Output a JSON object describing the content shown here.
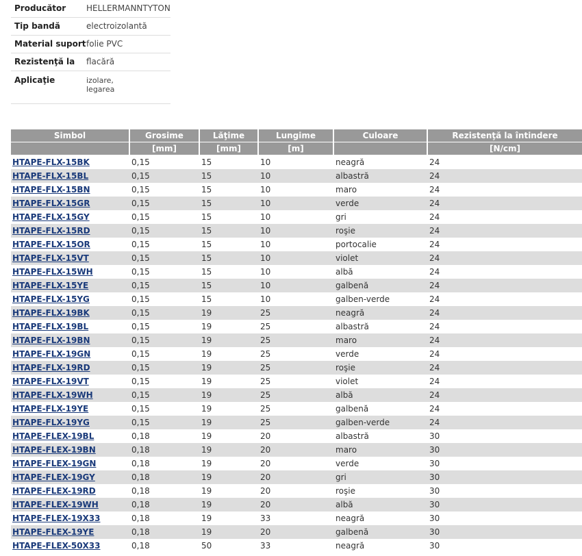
{
  "properties": [
    {
      "key": "Producător",
      "value": "HELLERMANNTYTON"
    },
    {
      "key": "Tip bandă",
      "value": "electroizolantă"
    },
    {
      "key": "Material suport",
      "value": "folie PVC"
    },
    {
      "key": "Rezistenţă la",
      "value": "flacără"
    },
    {
      "key": "Aplicaţie",
      "value": "izolare,\nlegarea"
    }
  ],
  "table": {
    "headers": [
      "Simbol",
      "Grosime",
      "Lăţime",
      "Lungime",
      "Culoare",
      "Rezistenţă la întindere"
    ],
    "units": [
      "",
      "[mm]",
      "[mm]",
      "[m]",
      "",
      "[N/cm]"
    ],
    "rows": [
      [
        "HTAPE-FLX-15BK",
        "0,15",
        "15",
        "10",
        "neagră",
        "24"
      ],
      [
        "HTAPE-FLX-15BL",
        "0,15",
        "15",
        "10",
        "albastră",
        "24"
      ],
      [
        "HTAPE-FLX-15BN",
        "0,15",
        "15",
        "10",
        "maro",
        "24"
      ],
      [
        "HTAPE-FLX-15GR",
        "0,15",
        "15",
        "10",
        "verde",
        "24"
      ],
      [
        "HTAPE-FLX-15GY",
        "0,15",
        "15",
        "10",
        "gri",
        "24"
      ],
      [
        "HTAPE-FLX-15RD",
        "0,15",
        "15",
        "10",
        "roşie",
        "24"
      ],
      [
        "HTAPE-FLX-15OR",
        "0,15",
        "15",
        "10",
        "portocalie",
        "24"
      ],
      [
        "HTAPE-FLX-15VT",
        "0,15",
        "15",
        "10",
        "violet",
        "24"
      ],
      [
        "HTAPE-FLX-15WH",
        "0,15",
        "15",
        "10",
        "albă",
        "24"
      ],
      [
        "HTAPE-FLX-15YE",
        "0,15",
        "15",
        "10",
        "galbenă",
        "24"
      ],
      [
        "HTAPE-FLX-15YG",
        "0,15",
        "15",
        "10",
        "galben-verde",
        "24"
      ],
      [
        "HTAPE-FLX-19BK",
        "0,15",
        "19",
        "25",
        "neagră",
        "24"
      ],
      [
        "HTAPE-FLX-19BL",
        "0,15",
        "19",
        "25",
        "albastră",
        "24"
      ],
      [
        "HTAPE-FLX-19BN",
        "0,15",
        "19",
        "25",
        "maro",
        "24"
      ],
      [
        "HTAPE-FLX-19GN",
        "0,15",
        "19",
        "25",
        "verde",
        "24"
      ],
      [
        "HTAPE-FLX-19RD",
        "0,15",
        "19",
        "25",
        "roşie",
        "24"
      ],
      [
        "HTAPE-FLX-19VT",
        "0,15",
        "19",
        "25",
        "violet",
        "24"
      ],
      [
        "HTAPE-FLX-19WH",
        "0,15",
        "19",
        "25",
        "albă",
        "24"
      ],
      [
        "HTAPE-FLX-19YE",
        "0,15",
        "19",
        "25",
        "galbenă",
        "24"
      ],
      [
        "HTAPE-FLX-19YG",
        "0,15",
        "19",
        "25",
        "galben-verde",
        "24"
      ],
      [
        "HTAPE-FLEX-19BL",
        "0,18",
        "19",
        "20",
        "albastră",
        "30"
      ],
      [
        "HTAPE-FLEX-19BN",
        "0,18",
        "19",
        "20",
        "maro",
        "30"
      ],
      [
        "HTAPE-FLEX-19GN",
        "0,18",
        "19",
        "20",
        "verde",
        "30"
      ],
      [
        "HTAPE-FLEX-19GY",
        "0,18",
        "19",
        "20",
        "gri",
        "30"
      ],
      [
        "HTAPE-FLEX-19RD",
        "0,18",
        "19",
        "20",
        "roşie",
        "30"
      ],
      [
        "HTAPE-FLEX-19WH",
        "0,18",
        "19",
        "20",
        "albă",
        "30"
      ],
      [
        "HTAPE-FLEX-19X33",
        "0,18",
        "19",
        "33",
        "neagră",
        "30"
      ],
      [
        "HTAPE-FLEX-19YE",
        "0,18",
        "19",
        "20",
        "galbenă",
        "30"
      ],
      [
        "HTAPE-FLEX-50X33",
        "0,18",
        "50",
        "33",
        "neagră",
        "30"
      ]
    ]
  },
  "colors": {
    "header_bg": "#999999",
    "row_alt_bg": "#dddddd",
    "link": "#1a3a7a"
  }
}
